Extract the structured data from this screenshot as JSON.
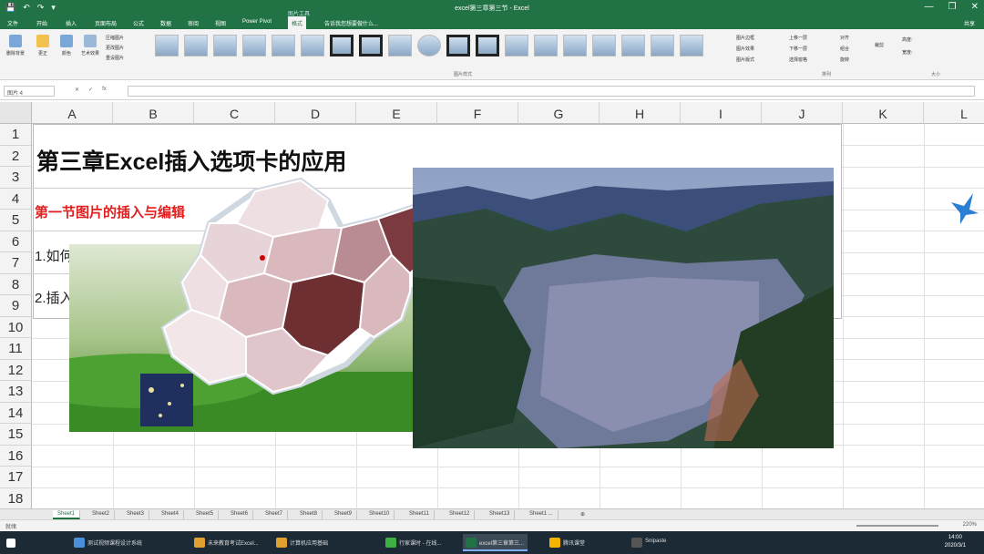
{
  "window": {
    "title": "excel第三章第三节 - Excel",
    "qat": [
      "💾",
      "↶",
      "↷",
      "▾"
    ],
    "controls": [
      "—",
      "❐",
      "✕"
    ]
  },
  "ribbon_tabs": {
    "items": [
      "文件",
      "开始",
      "插入",
      "页面布局",
      "公式",
      "数据",
      "审阅",
      "视图",
      "Power Pivot",
      "格式"
    ],
    "context_label": "图片工具",
    "tell_me": "告诉我您想要做什么...",
    "share": "共享"
  },
  "ribbon": {
    "remove_background": "删除背景",
    "corrections": "更正",
    "color": "颜色",
    "artistic_effects": "艺术效果",
    "compress": "压缩图片",
    "change": "更改图片",
    "reset": "重设图片",
    "picture_styles_label": "图片样式",
    "border": "图片边框",
    "effects": "图片效果",
    "layout": "图片版式",
    "bring_forward": "上移一层",
    "send_backward": "下移一层",
    "selection_pane": "选择窗格",
    "align": "对齐",
    "group": "组合",
    "rotate": "旋转",
    "arrange_label": "排列",
    "crop": "裁剪",
    "height": "高度:",
    "width": "宽度:",
    "size_label": "大小"
  },
  "formula_bar": {
    "name_box": "图片 4",
    "icons": [
      "✕",
      "✓",
      "fx"
    ],
    "value": ""
  },
  "columns": [
    "A",
    "B",
    "C",
    "D",
    "E",
    "F",
    "G",
    "H",
    "I",
    "J",
    "K",
    "L"
  ],
  "rows": [
    "1",
    "2",
    "3",
    "4",
    "5",
    "6",
    "7",
    "8",
    "9",
    "10",
    "11",
    "12",
    "13",
    "14",
    "15",
    "16",
    "17",
    "18"
  ],
  "content": {
    "heading": "第三章Excel插入选项卡的应用",
    "subheading": "第一节图片的插入与编辑",
    "item1": "1.如何",
    "item2": "2.插入"
  },
  "sheet_tabs": {
    "items": [
      "Sheet1",
      "Sheet2",
      "Sheet3",
      "Sheet4",
      "Sheet5",
      "Sheet6",
      "Sheet7",
      "Sheet8",
      "Sheet9",
      "Sheet10",
      "Sheet11",
      "Sheet12",
      "Sheet13",
      "Sheet1 ..."
    ],
    "add": "⊕"
  },
  "status": {
    "ready": "就绪",
    "zoom": "220%"
  },
  "taskbar": {
    "items": [
      "测试视频课程设计系统",
      "未来教育考试Excel...",
      "计算机应用基础",
      "行家课时 - 在线...",
      "excel第三章第三...",
      "腾讯课堂",
      "Snipaste"
    ],
    "time": "14:00",
    "date": "2020/3/1"
  },
  "colors": {
    "excel_green": "#217346",
    "heading_red": "#e02020"
  }
}
